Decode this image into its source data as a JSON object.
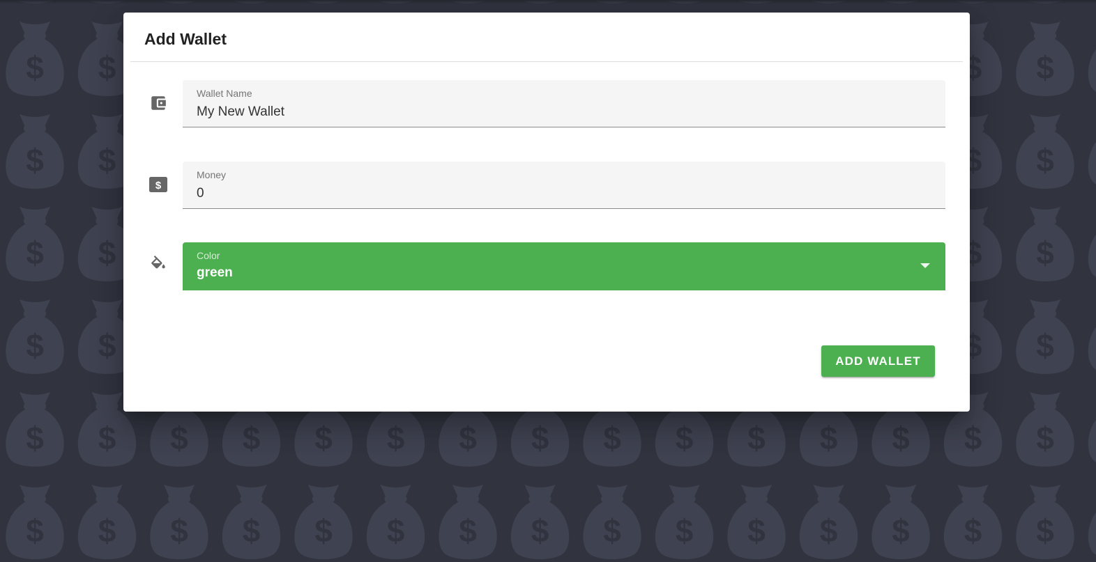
{
  "dialog": {
    "title": "Add Wallet"
  },
  "fields": {
    "wallet_name": {
      "label": "Wallet Name",
      "value": "My New Wallet",
      "icon": "wallet-icon"
    },
    "money": {
      "label": "Money",
      "value": "0",
      "icon": "money-bill-icon"
    },
    "color": {
      "label": "Color",
      "value": "green",
      "icon": "paint-bucket-icon"
    }
  },
  "actions": {
    "add_label": "Add Wallet"
  },
  "background": {
    "pattern_icon": "money-bag-icon",
    "pattern_glyph": "$"
  },
  "colors": {
    "accent": "#4caf50",
    "background": "#31343f",
    "pattern": "#3f4250",
    "icon": "#666666"
  }
}
